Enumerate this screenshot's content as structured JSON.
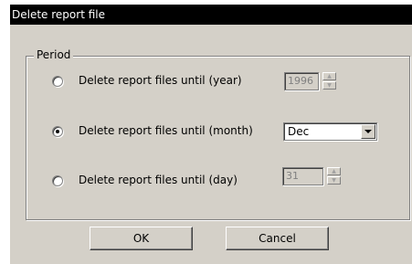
{
  "dialog": {
    "title": "Delete report file"
  },
  "period": {
    "label": "Period",
    "options": [
      {
        "label": "Delete report files until (year)",
        "selected": false,
        "value": "1996",
        "enabled": false
      },
      {
        "label": "Delete report files until (month)",
        "selected": true,
        "value": "Dec",
        "enabled": true
      },
      {
        "label": "Delete report files until (day)",
        "selected": false,
        "value": "31",
        "enabled": false
      }
    ]
  },
  "buttons": {
    "ok_label": "OK",
    "cancel_label": "Cancel"
  },
  "colors": {
    "titlebar": "#000000",
    "dialog_face": "#d4d0c8"
  }
}
